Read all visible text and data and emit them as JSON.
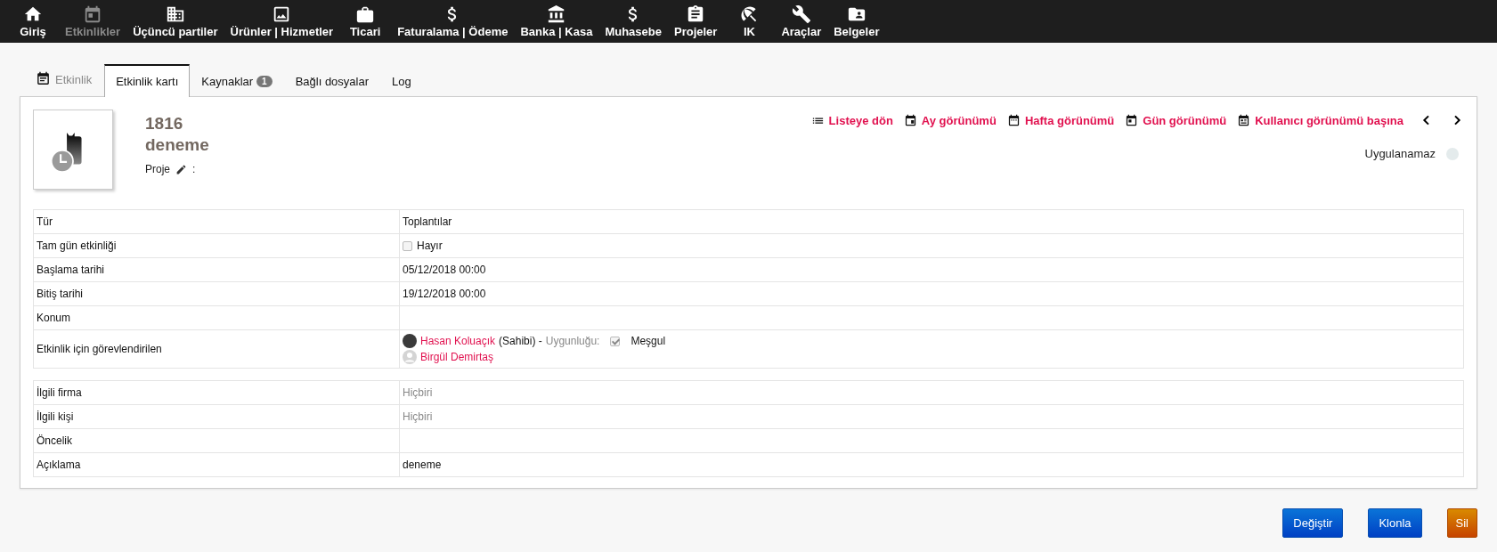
{
  "nav": [
    {
      "label": "Giriş",
      "selected": false
    },
    {
      "label": "Etkinlikler",
      "selected": true
    },
    {
      "label": "Üçüncü partiler",
      "selected": false
    },
    {
      "label": "Ürünler | Hizmetler",
      "selected": false
    },
    {
      "label": "Ticari",
      "selected": false
    },
    {
      "label": "Faturalama | Ödeme",
      "selected": false
    },
    {
      "label": "Banka | Kasa",
      "selected": false
    },
    {
      "label": "Muhasebe",
      "selected": false
    },
    {
      "label": "Projeler",
      "selected": false
    },
    {
      "label": "IK",
      "selected": false
    },
    {
      "label": "Araçlar",
      "selected": false
    },
    {
      "label": "Belgeler",
      "selected": false
    }
  ],
  "tabs_title": "Etkinlik",
  "tabs": [
    {
      "label": "Etkinlik kartı",
      "selected": true
    },
    {
      "label": "Kaynaklar",
      "badge": "1",
      "selected": false
    },
    {
      "label": "Bağlı dosyalar",
      "selected": false
    },
    {
      "label": "Log",
      "selected": false
    }
  ],
  "header": {
    "ref": "1816",
    "label": "deneme",
    "project_label": "Proje",
    "project_sep": ":"
  },
  "actions": [
    {
      "label": "Listeye dön"
    },
    {
      "label": "Ay görünümü"
    },
    {
      "label": "Hafta görünümü"
    },
    {
      "label": "Gün görünümü"
    },
    {
      "label": "Kullanıcı görünümü başına"
    }
  ],
  "status": {
    "label": "Uygulanamaz",
    "color": "#e4ebec"
  },
  "table_1": [
    {
      "kind": "text",
      "label": "Tür",
      "value": "Toplantılar"
    },
    {
      "kind": "checkbox",
      "label": "Tam gün etkinliği",
      "value": "Hayır",
      "checked": false
    },
    {
      "kind": "text",
      "label": "Başlama tarihi",
      "value": "05/12/2018 00:00"
    },
    {
      "kind": "text",
      "label": "Bitiş tarihi",
      "value": "19/12/2018 00:00"
    },
    {
      "kind": "text",
      "label": "Konum"
    },
    {
      "kind": "people",
      "label": "Etkinlik için görevlendirilen",
      "people": [
        {
          "kind": "photo",
          "name": "Hasan Koluaçık",
          "role": "(Sahibi) -",
          "availability_label": "Uygunluğu:",
          "busy": true,
          "busy_label": "Meşgul"
        },
        {
          "kind": "default",
          "name": "Birgül Demirtaş"
        }
      ]
    }
  ],
  "table_2": [
    {
      "kind": "none",
      "label": "İlgili firma",
      "value": "Hiçbiri"
    },
    {
      "kind": "none",
      "label": "İlgili kişi",
      "value": "Hiçbiri"
    },
    {
      "kind": "text",
      "label": "Öncelik"
    },
    {
      "kind": "text",
      "label": "Açıklama",
      "value": "deneme"
    }
  ],
  "buttons": [
    {
      "label": "Değiştir",
      "kind": "primary"
    },
    {
      "label": "Klonla",
      "kind": "primary"
    },
    {
      "label": "Sil",
      "kind": "danger"
    }
  ]
}
